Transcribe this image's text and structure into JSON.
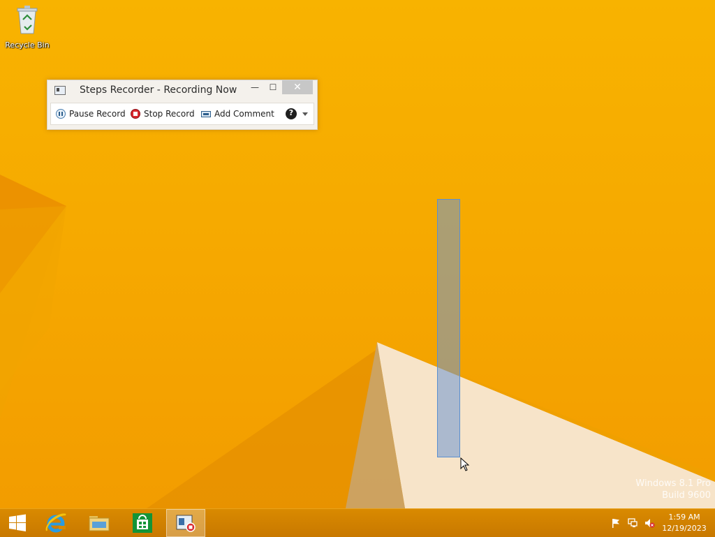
{
  "desktop": {
    "recycle_bin_label": "Recycle Bin",
    "watermark_line1": "Windows 8.1 Pro",
    "watermark_line2": "Build 9600"
  },
  "steps_recorder": {
    "title": "Steps Recorder - Recording Now",
    "pause_label": "Pause Record",
    "stop_label": "Stop Record",
    "add_comment_label": "Add Comment",
    "help_glyph": "?",
    "close_glyph": "✕",
    "minimize_glyph": "—",
    "maximize_glyph": "☐"
  },
  "taskbar": {
    "pinned": [
      "start",
      "internet-explorer",
      "file-explorer",
      "windows-store",
      "steps-recorder"
    ],
    "clock_time": "1:59 AM",
    "clock_date": "12/19/2023"
  },
  "colors": {
    "wallpaper": "#f8b300",
    "taskbar": "#d98a00",
    "selection": "#6e96d2"
  }
}
